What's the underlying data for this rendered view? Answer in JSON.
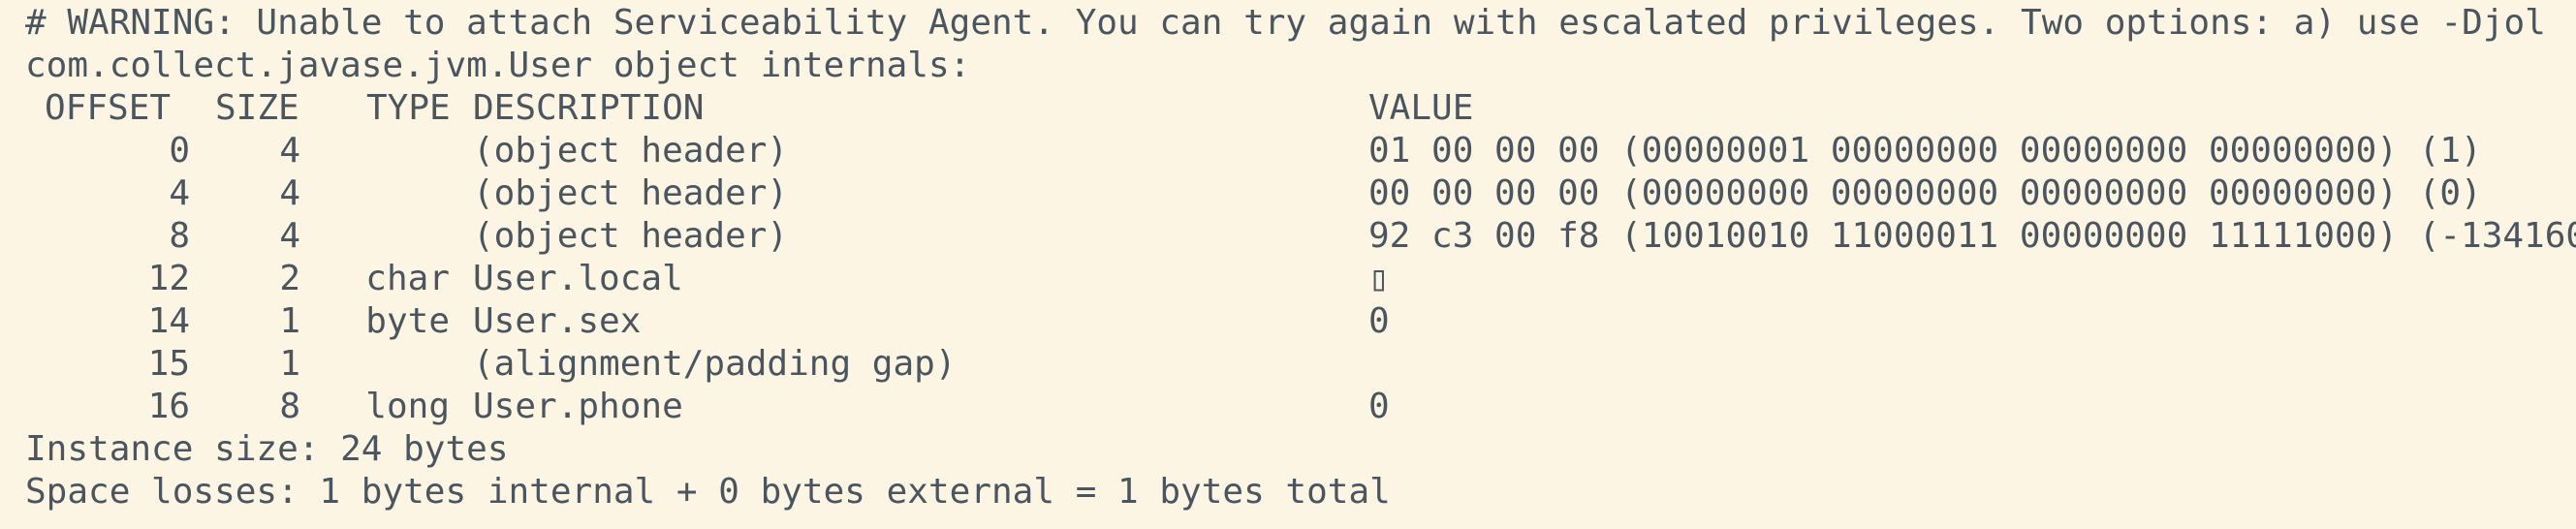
{
  "terminal": {
    "warning": "# WARNING: Unable to attach Serviceability Agent. You can try again with escalated privileges. Two options: a) use -Djol",
    "class_line": "com.collect.javase.jvm.User object internals:",
    "headers": {
      "offset": "OFFSET",
      "size": "SIZE",
      "type": "TYPE",
      "description": "DESCRIPTION",
      "value": "VALUE"
    },
    "rows": [
      {
        "offset": "0",
        "size": "4",
        "type": "",
        "description": "(object header)",
        "value": "01 00 00 00 (00000001 00000000 00000000 00000000) (1)"
      },
      {
        "offset": "4",
        "size": "4",
        "type": "",
        "description": "(object header)",
        "value": "00 00 00 00 (00000000 00000000 00000000 00000000) (0)"
      },
      {
        "offset": "8",
        "size": "4",
        "type": "",
        "description": "(object header)",
        "value": "92 c3 00 f8 (10010010 11000011 00000000 11111000) (-134160"
      },
      {
        "offset": "12",
        "size": "2",
        "type": "char",
        "description": "User.local",
        "value": "▯"
      },
      {
        "offset": "14",
        "size": "1",
        "type": "byte",
        "description": "User.sex",
        "value": "0"
      },
      {
        "offset": "15",
        "size": "1",
        "type": "",
        "description": "(alignment/padding gap)",
        "value": ""
      },
      {
        "offset": "16",
        "size": "8",
        "type": "long",
        "description": "User.phone",
        "value": "0"
      }
    ],
    "instance_size": "Instance size: 24 bytes",
    "space_losses": "Space losses: 1 bytes internal + 0 bytes external = 1 bytes total"
  }
}
